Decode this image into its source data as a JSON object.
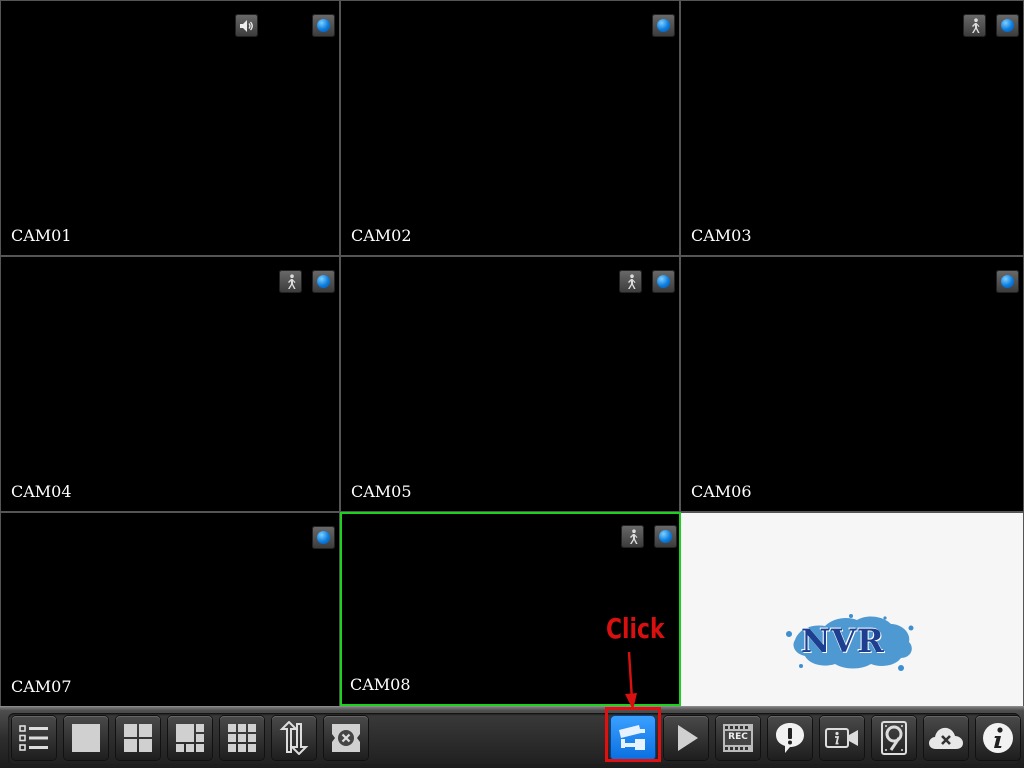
{
  "cameras": [
    {
      "label": "CAM01",
      "audio": true,
      "motion": false,
      "record": true
    },
    {
      "label": "CAM02",
      "audio": false,
      "motion": false,
      "record": true
    },
    {
      "label": "CAM03",
      "audio": false,
      "motion": true,
      "record": true
    },
    {
      "label": "CAM04",
      "audio": false,
      "motion": true,
      "record": true
    },
    {
      "label": "CAM05",
      "audio": false,
      "motion": true,
      "record": true
    },
    {
      "label": "CAM06",
      "audio": false,
      "motion": false,
      "record": true
    },
    {
      "label": "CAM07",
      "audio": false,
      "motion": false,
      "record": true
    },
    {
      "label": "CAM08",
      "audio": false,
      "motion": true,
      "record": true,
      "selected": true
    }
  ],
  "logo": {
    "text": "NVR",
    "text_color": "#1e3f8f",
    "splash_color": "#3d8fcf"
  },
  "toolbar": {
    "buttons": [
      {
        "name": "menu-list-button",
        "icon": "list-icon"
      },
      {
        "name": "layout-1-button",
        "icon": "single-view-icon"
      },
      {
        "name": "layout-4-button",
        "icon": "quad-view-icon"
      },
      {
        "name": "layout-6-button",
        "icon": "six-view-icon"
      },
      {
        "name": "layout-9-button",
        "icon": "nine-view-icon"
      },
      {
        "name": "sequence-button",
        "icon": "swap-arrows-icon"
      },
      {
        "name": "close-all-button",
        "icon": "close-box-icon"
      },
      {
        "name": "ptz-camera-button",
        "icon": "cctv-camera-icon",
        "active": true
      },
      {
        "name": "playback-button",
        "icon": "play-icon"
      },
      {
        "name": "record-button",
        "icon": "rec-film-icon",
        "label": "REC"
      },
      {
        "name": "alarm-button",
        "icon": "alert-bubble-icon"
      },
      {
        "name": "video-info-button",
        "icon": "camera-info-icon"
      },
      {
        "name": "hdd-button",
        "icon": "hard-disk-icon"
      },
      {
        "name": "cloud-button",
        "icon": "cloud-off-icon"
      },
      {
        "name": "info-button",
        "icon": "info-icon"
      }
    ]
  },
  "annotation": {
    "text": "Click",
    "color": "#d81010"
  }
}
